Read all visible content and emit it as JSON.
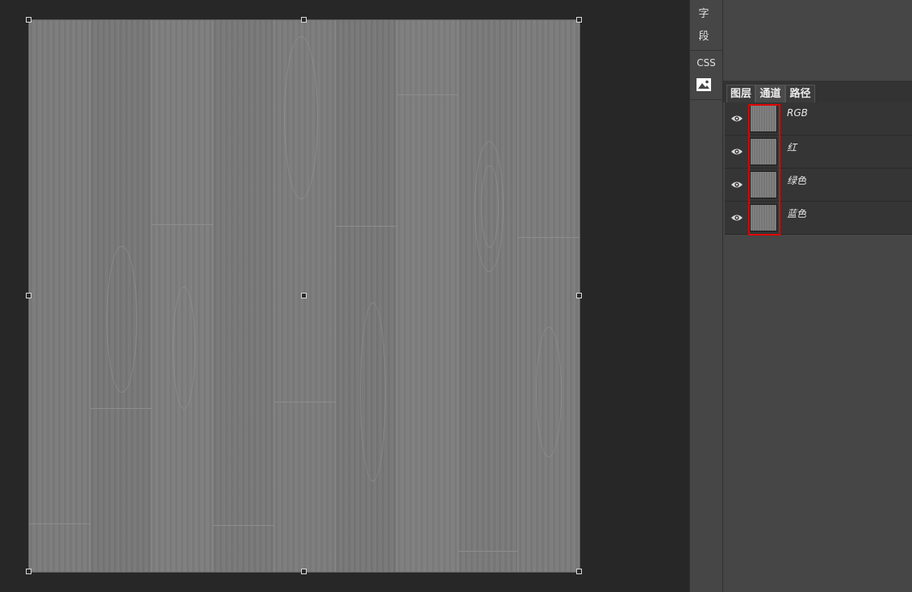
{
  "dock": {
    "char_label_1": "字",
    "char_label_2": "段",
    "css_label": "CSS",
    "image_icon": "image-icon"
  },
  "panel": {
    "tabs": [
      {
        "label": "图层",
        "active": false
      },
      {
        "label": "通道",
        "active": true
      },
      {
        "label": "路径",
        "active": false
      }
    ],
    "channels": [
      {
        "name": "RGB",
        "visible_icon": "eye-icon"
      },
      {
        "name": "红",
        "visible_icon": "eye-icon"
      },
      {
        "name": "绿色",
        "visible_icon": "eye-icon"
      },
      {
        "name": "蓝色",
        "visible_icon": "eye-icon"
      }
    ]
  },
  "canvas": {
    "content": "gray wood floor texture",
    "bg_color": "#7a7a7a"
  },
  "colors": {
    "highlight": "#e00000",
    "panel_bg": "#464646",
    "app_bg": "#272727"
  }
}
